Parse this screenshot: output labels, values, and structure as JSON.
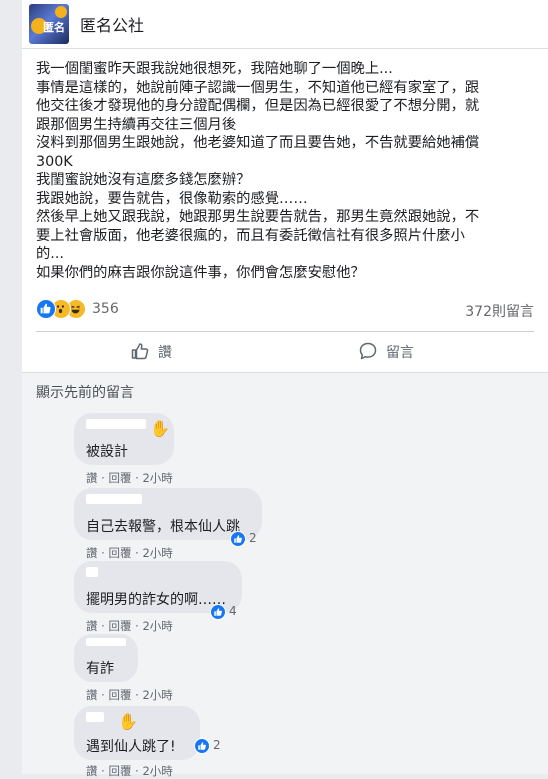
{
  "header": {
    "page_name": "匿名公社",
    "avatar_text": "匿名"
  },
  "post": {
    "lines": [
      "我一個閨蜜昨天跟我說她很想死，我陪她聊了一個晚上...",
      "事情是這樣的，她說前陣子認識一個男生，不知道他已經有家室了，跟",
      "他交往後才發現他的身分證配偶欄，但是因為已經很愛了不想分開，就",
      "跟那個男生持續再交往三個月後",
      "沒料到那個男生跟她說，他老婆知道了而且要告她，不告就要給她補償",
      "300K",
      "我閨蜜說她沒有這麼多錢怎麼辦？",
      "我跟她說，要告就告，很像勒索的感覺……",
      "然後早上她又跟我說，她跟那男生說要告就告，那男生竟然跟她說，不",
      "要上社會版面，他老婆很瘋的，而且有委託徵信社有很多照片什麼小",
      "的...",
      "如果你們的麻吉跟你說這件事，你們會怎麼安慰他？"
    ],
    "reaction_count": "356",
    "comment_count": "372則留言",
    "like_label": "讚",
    "comment_label": "留言"
  },
  "comments_section": {
    "view_previous": "顯示先前的留言",
    "comments": [
      {
        "text": "被設計",
        "like": "讚",
        "reply": "回覆",
        "time": "2小時",
        "reactions": ""
      },
      {
        "text": "自己去報警，根本仙人跳",
        "like": "讚",
        "reply": "回覆",
        "time": "2小時",
        "reactions": "2"
      },
      {
        "text": "擺明男的詐女的啊……",
        "like": "讚",
        "reply": "回覆",
        "time": "2小時",
        "reactions": "4"
      },
      {
        "text": "有詐",
        "like": "讚",
        "reply": "回覆",
        "time": "2小時",
        "reactions": ""
      },
      {
        "text": "遇到仙人跳了!",
        "like": "讚",
        "reply": "回覆",
        "time": "2小時",
        "reactions": "2"
      }
    ],
    "dot_separator": "·"
  },
  "colors": {
    "facebook_blue": "#1877f2",
    "reaction_yellow": "#f7b928",
    "bubble_gray": "#e4e6eb",
    "meta_gray": "#606770"
  }
}
